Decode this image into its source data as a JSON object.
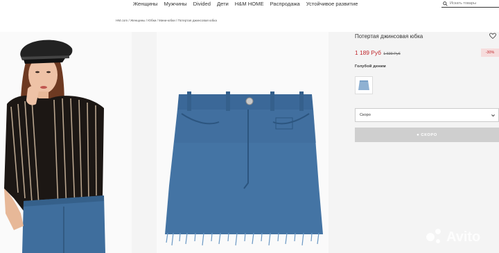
{
  "nav": {
    "items": [
      "Женщины",
      "Мужчины",
      "Divided",
      "Дети",
      "H&M HOME",
      "Распродажа",
      "Устойчивое развитие"
    ],
    "search_placeholder": "Искать товары"
  },
  "breadcrumb": "HM.com / Женщины / Юбки / Мини-юбки / Потертая джинсовая юбка",
  "product": {
    "title": "Потертая джинсовая юбка",
    "price": "1 189 Руб",
    "old_price": "1 699 Руб",
    "discount": "-30%",
    "color_label": "Голубой деним",
    "size_select": "Скоро",
    "cta_label": "СКОРО"
  },
  "watermark": "Avito",
  "colors": {
    "sale": "#c0282d",
    "denim": "#3f6e9d",
    "cta_bg": "#cfcfcf"
  }
}
